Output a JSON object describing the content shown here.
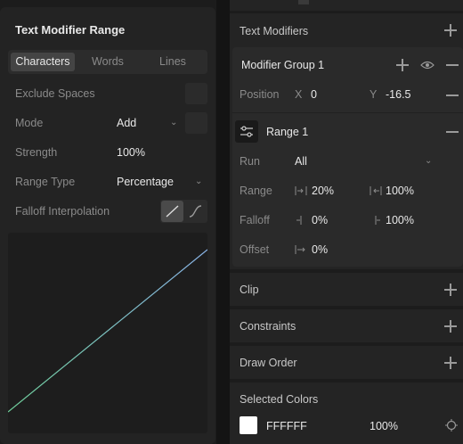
{
  "left_panel": {
    "title": "Text Modifier Range",
    "tabs": [
      "Characters",
      "Words",
      "Lines"
    ],
    "exclude_spaces_label": "Exclude Spaces",
    "mode_label": "Mode",
    "mode_value": "Add",
    "strength_label": "Strength",
    "strength_value": "100%",
    "range_type_label": "Range Type",
    "range_type_value": "Percentage",
    "falloff_interp_label": "Falloff Interpolation"
  },
  "right_panel": {
    "text_modifiers_label": "Text Modifiers",
    "modifier_group_label": "Modifier Group 1",
    "position_label": "Position",
    "position_x_label": "X",
    "position_x_value": "0",
    "position_y_label": "Y",
    "position_y_value": "-16.5",
    "range_title": "Range 1",
    "run_label": "Run",
    "run_value": "All",
    "range_label": "Range",
    "range_start": "20%",
    "range_end": "100%",
    "falloff_label": "Falloff",
    "falloff_start": "0%",
    "falloff_end": "100%",
    "offset_label": "Offset",
    "offset_value": "0%",
    "sections": [
      "Clip",
      "Constraints",
      "Draw Order"
    ],
    "selected_colors_label": "Selected Colors",
    "color_hex": "FFFFFF",
    "color_opacity": "100%"
  },
  "colors": {
    "curve_start": "#6fcf9a",
    "curve_end": "#8ab4e8",
    "swatch": "#ffffff"
  }
}
